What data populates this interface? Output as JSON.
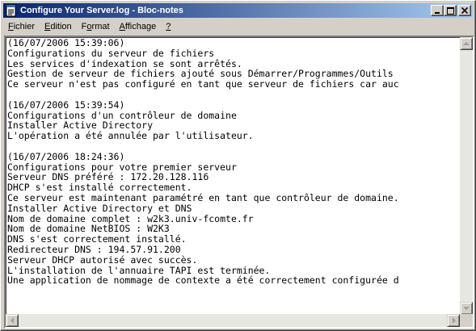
{
  "window": {
    "title": "Configure Your Server.log - Bloc-notes"
  },
  "menu": {
    "items": [
      {
        "label": "Fichier",
        "name": "menu-fichier"
      },
      {
        "label": "Edition",
        "name": "menu-edition"
      },
      {
        "label": "Format",
        "name": "menu-format"
      },
      {
        "label": "Affichage",
        "name": "menu-affichage"
      },
      {
        "label": "?",
        "name": "menu-help"
      }
    ]
  },
  "document": {
    "lines": [
      "(16/07/2006 15:39:06)",
      "Configurations du serveur de fichiers",
      "Les services d'indexation se sont arrêtés.",
      "Gestion de serveur de fichiers ajouté sous Démarrer/Programmes/Outils",
      "Ce serveur n'est pas configuré en tant que serveur de fichiers car auc",
      "",
      "(16/07/2006 15:39:54)",
      "Configurations d'un contrôleur de domaine",
      "Installer Active Directory",
      "L'opération a été annulée par l'utilisateur.",
      "",
      "(16/07/2006 18:24:36)",
      "Configurations pour votre premier serveur",
      "Serveur DNS préféré : 172.20.128.116",
      "DHCP s'est installé correctement.",
      "Ce serveur est maintenant paramétré en tant que contrôleur de domaine.",
      "Installer Active Directory et DNS",
      "Nom de domaine complet : w2k3.univ-fcomte.fr",
      "Nom de domaine NetBIOS : W2K3",
      "DNS s'est correctement installé.",
      "Redirecteur DNS : 194.57.91.200",
      "Serveur DHCP autorisé avec succès.",
      "L'installation de l'annuaire TAPI est terminée.",
      "Une application de nommage de contexte a été correctement configurée d"
    ]
  },
  "icons": {
    "app": "notepad-icon",
    "minimize": "minimize-icon",
    "maximize": "maximize-icon",
    "close": "close-icon"
  }
}
